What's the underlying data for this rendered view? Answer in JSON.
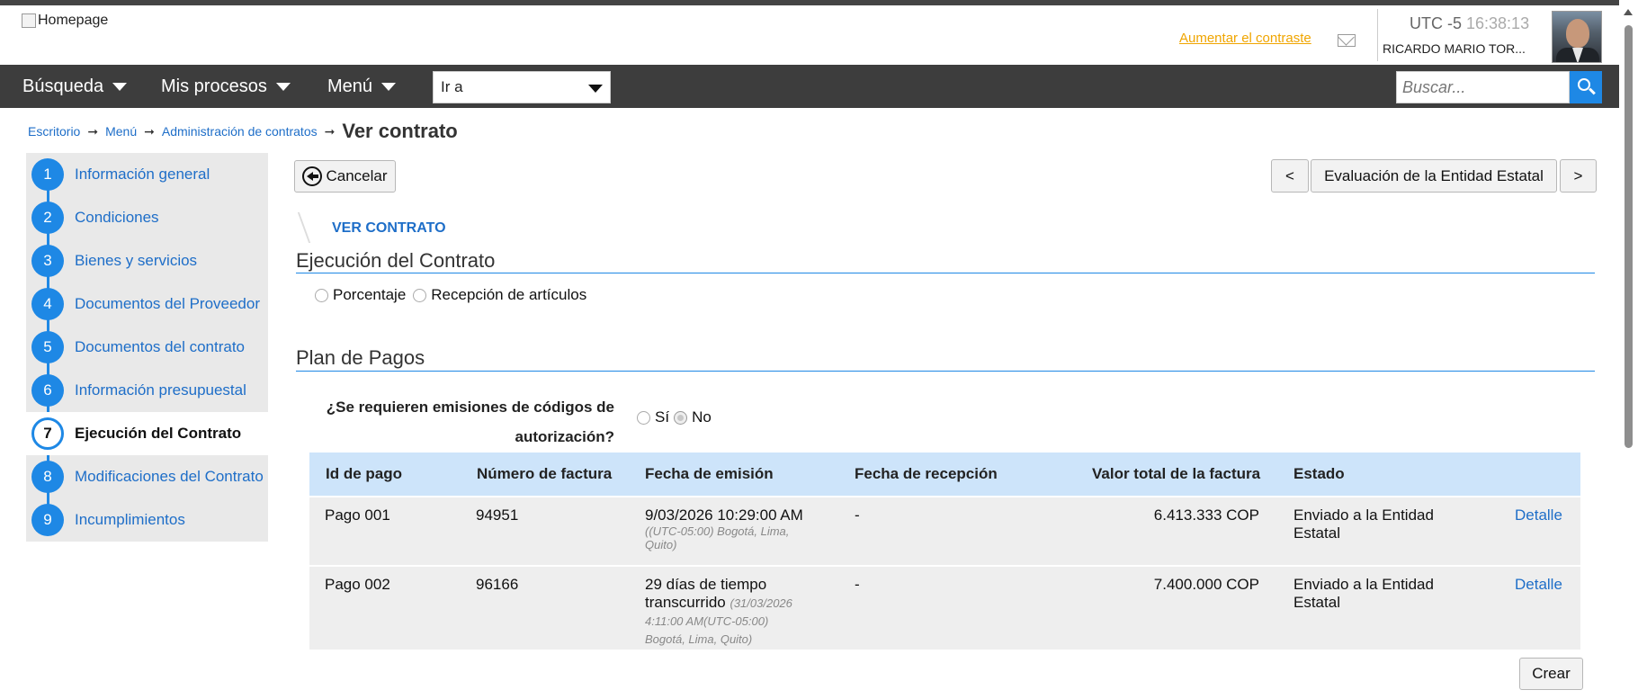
{
  "header": {
    "logo_alt": "Homepage",
    "contrast_link": "Aumentar el contraste",
    "timezone": "UTC -5",
    "time": "16:38:13",
    "username": "RICARDO MARIO TOR...",
    "icons": [
      "mail-icon",
      "avatar"
    ]
  },
  "navbar": {
    "items": [
      {
        "label": "Búsqueda"
      },
      {
        "label": "Mis procesos"
      },
      {
        "label": "Menú"
      }
    ],
    "goto_value": "Ir a",
    "search_placeholder": "Buscar...",
    "colors": {
      "bar": "#3d3d3d",
      "search_button": "#1e88e5"
    }
  },
  "breadcrumb": {
    "items": [
      "Escritorio",
      "Menú",
      "Administración de contratos"
    ],
    "separator": "➞",
    "current": "Ver contrato"
  },
  "steps": [
    {
      "num": "1",
      "label": "Información general"
    },
    {
      "num": "2",
      "label": "Condiciones"
    },
    {
      "num": "3",
      "label": "Bienes y servicios"
    },
    {
      "num": "4",
      "label": "Documentos del Proveedor"
    },
    {
      "num": "5",
      "label": "Documentos del contrato"
    },
    {
      "num": "6",
      "label": "Información presupuestal"
    },
    {
      "num": "7",
      "label": "Ejecución del Contrato",
      "active": true
    },
    {
      "num": "8",
      "label": "Modificaciones del Contrato"
    },
    {
      "num": "9",
      "label": "Incumplimientos"
    }
  ],
  "toolbar": {
    "cancel_label": "Cancelar",
    "prev_label": "<",
    "next_step_label": "Evaluación de la Entidad Estatal",
    "next_label": ">"
  },
  "main": {
    "section_tag": "VER CONTRATO",
    "execution_title": "Ejecución del Contrato",
    "execution_options": [
      "Porcentaje",
      "Recepción de artículos"
    ],
    "payment_plan_title": "Plan de Pagos",
    "auth_codes_question": "¿Se requieren emisiones de códigos de autorización?",
    "auth_codes_options": [
      "Sí",
      "No"
    ],
    "auth_codes_selected": "No"
  },
  "payments_table": {
    "columns": [
      "Id de pago",
      "Número de factura",
      "Fecha de emisión",
      "Fecha de recepción",
      "Valor total de la factura",
      "Estado"
    ],
    "rows": [
      {
        "id": "Pago 001",
        "invoice": "94951",
        "issue_date": "9/03/2026 10:29:00 AM",
        "issue_date_note": "((UTC-05:00) Bogotá, Lima, Quito)",
        "received_date": "-",
        "total": "6.413.333 COP",
        "status": "Enviado a la Entidad Estatal",
        "action": "Detalle"
      },
      {
        "id": "Pago 002",
        "invoice": "96166",
        "issue_date": "29 días de tiempo transcurrido",
        "issue_date_note": "(31/03/2026 4:11:00 AM(UTC-05:00) Bogotá, Lima, Quito)",
        "received_date": "-",
        "total": "7.400.000 COP",
        "status": "Enviado a la Entidad Estatal",
        "action": "Detalle"
      }
    ]
  },
  "create_label": "Crear"
}
